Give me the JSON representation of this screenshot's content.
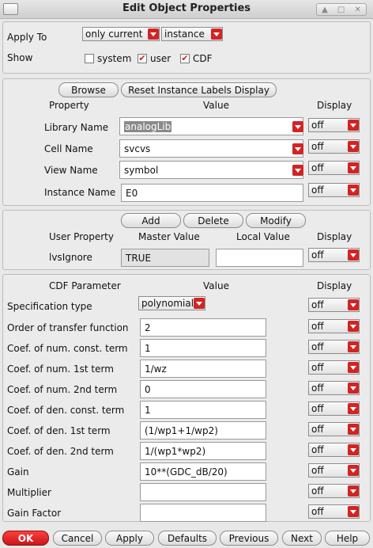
{
  "window": {
    "title": "Edit Object Properties"
  },
  "top": {
    "apply_to_label": "Apply To",
    "apply_to_scope": "only current",
    "apply_to_object": "instance",
    "show_label": "Show",
    "show_options": [
      {
        "label": "system",
        "checked": false
      },
      {
        "label": "user",
        "checked": true
      },
      {
        "label": "CDF",
        "checked": true
      }
    ]
  },
  "instance_section": {
    "browse_label": "Browse",
    "reset_label": "Reset Instance Labels Display",
    "col_property": "Property",
    "col_value": "Value",
    "col_display": "Display",
    "rows": [
      {
        "label": "Library Name",
        "value": "analogLib",
        "display": "off"
      },
      {
        "label": "Cell Name",
        "value": "svcvs",
        "display": "off"
      },
      {
        "label": "View Name",
        "value": "symbol",
        "display": "off"
      },
      {
        "label": "Instance Name",
        "value": "E0",
        "display": "off"
      }
    ]
  },
  "user_section": {
    "add_label": "Add",
    "delete_label": "Delete",
    "modify_label": "Modify",
    "col_user_property": "User Property",
    "col_master_value": "Master Value",
    "col_local_value": "Local Value",
    "col_display": "Display",
    "row": {
      "label": "lvsIgnore",
      "master": "TRUE",
      "local": "",
      "display": "off"
    }
  },
  "cdf_section": {
    "col_param": "CDF Parameter",
    "col_value": "Value",
    "col_display": "Display",
    "spec_label": "Specification type",
    "spec_value": "polynomial",
    "spec_display": "off",
    "params": [
      {
        "label": "Order of transfer function",
        "value": "2",
        "display": "off"
      },
      {
        "label": "Coef. of num. const. term",
        "value": "1",
        "display": "off"
      },
      {
        "label": "Coef. of num. 1st term",
        "value": "1/wz",
        "display": "off"
      },
      {
        "label": "Coef. of num. 2nd term",
        "value": "0",
        "display": "off"
      },
      {
        "label": "Coef. of den. const. term",
        "value": "1",
        "display": "off"
      },
      {
        "label": "Coef. of den. 1st term",
        "value": "(1/wp1+1/wp2)",
        "display": "off"
      },
      {
        "label": "Coef. of den. 2nd term",
        "value": "1/(wp1*wp2)",
        "display": "off"
      },
      {
        "label": "Gain",
        "value": "10**(GDC_dB/20)",
        "display": "off"
      },
      {
        "label": "Multiplier",
        "value": "",
        "display": "off"
      },
      {
        "label": "Gain Factor",
        "value": "",
        "display": "off"
      }
    ]
  },
  "footer": {
    "ok": "OK",
    "cancel": "Cancel",
    "apply": "Apply",
    "defaults": "Defaults",
    "previous": "Previous",
    "next": "Next",
    "help": "Help"
  }
}
